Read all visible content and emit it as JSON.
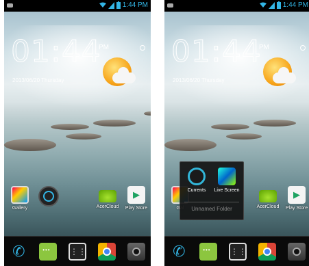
{
  "status": {
    "time": "1:44 PM"
  },
  "clock": {
    "time": "01:44",
    "ampm": "PM",
    "date": "2013/06/20 Thursday"
  },
  "left_screen": {
    "home_icons": [
      {
        "label": "Gallery",
        "icon": "gallery-icon"
      },
      {
        "label": "",
        "icon": "folder-icon"
      },
      {
        "label": "AcerCloud",
        "icon": "acercloud-icon"
      },
      {
        "label": "Play Store",
        "icon": "play-store-icon"
      }
    ]
  },
  "right_screen": {
    "home_icons": [
      {
        "label": "Gal",
        "icon": "gallery-icon"
      },
      {
        "label": "AcerCloud",
        "icon": "acercloud-icon"
      },
      {
        "label": "Play Store",
        "icon": "play-store-icon"
      }
    ],
    "folder": {
      "name": "Unnamed Folder",
      "items": [
        {
          "label": "Currents",
          "icon": "currents-icon"
        },
        {
          "label": "Live Screen",
          "icon": "live-screen-icon"
        }
      ]
    }
  },
  "dock": [
    "phone-icon",
    "messaging-icon",
    "apps-drawer-icon",
    "chrome-icon",
    "camera-icon"
  ],
  "colors": {
    "accent": "#33b5e5",
    "status_bg": "#000000"
  }
}
